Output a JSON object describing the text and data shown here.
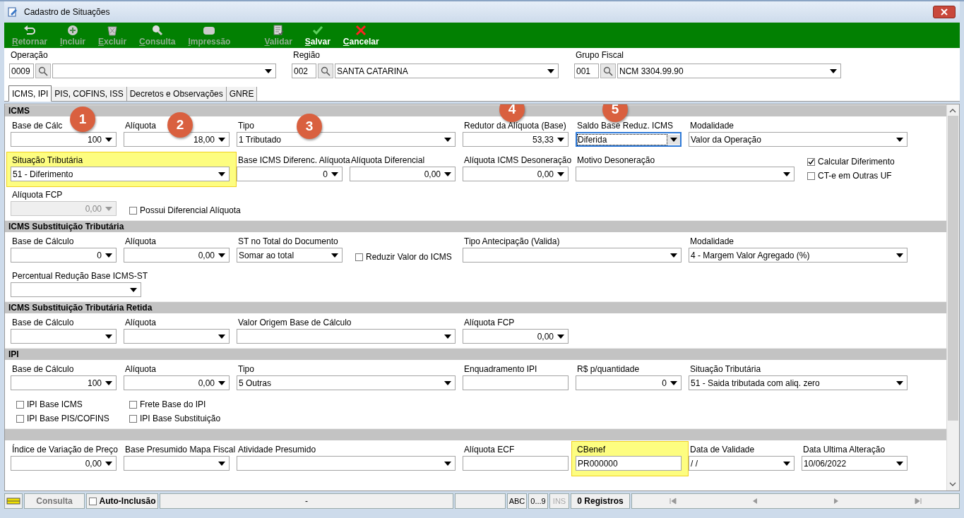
{
  "window": {
    "title": "Cadastro de Situações"
  },
  "toolbar": [
    {
      "label": "Retornar",
      "kind": "back",
      "disabled": true
    },
    {
      "label": "Incluir",
      "kind": "add",
      "disabled": true
    },
    {
      "label": "Excluir",
      "kind": "delete",
      "disabled": true
    },
    {
      "label": "Consulta",
      "kind": "search",
      "disabled": true
    },
    {
      "label": "Impressão",
      "kind": "print",
      "disabled": true
    },
    {
      "label": "Validar",
      "kind": "validate",
      "disabled": true
    },
    {
      "label": "Salvar",
      "kind": "save",
      "disabled": false
    },
    {
      "label": "Cancelar",
      "kind": "cancel",
      "disabled": false
    }
  ],
  "header": [
    {
      "label": "Operação",
      "code": "0009"
    },
    {
      "label": "Região",
      "code": "002",
      "value": "SANTA CATARINA"
    },
    {
      "label": "Grupo Fiscal",
      "code": "001",
      "value": "NCM 3304.99.90"
    }
  ],
  "tabs": [
    {
      "label": "ICMS, IPI",
      "selected": true
    },
    {
      "label": "PIS, COFINS, ISS",
      "selected": false
    },
    {
      "label": "Decretos e Observações",
      "selected": false
    },
    {
      "label": "GNRE",
      "selected": false
    }
  ],
  "sections": [
    {
      "title": "ICMS",
      "lines": [
        {
          "fields": [
            {
              "kind": "number",
              "label": "Base de Cálc",
              "value": "100",
              "callout": "1"
            },
            {
              "kind": "number",
              "label": "Alíquota",
              "value": "18,00",
              "callout": "2"
            },
            {
              "kind": "combo",
              "label": "Tipo",
              "value": "1 Tributado",
              "callout": "3"
            },
            {
              "kind": "number",
              "label": "Redutor da Alíquota (Base)",
              "value": "53,33",
              "callout": "4"
            },
            {
              "kind": "combo",
              "label": "Saldo Base Reduz. ICMS",
              "value": "Diferida",
              "callout": "5",
              "focused": true
            },
            {
              "kind": "combo",
              "label": "Modalidade",
              "value": "Valor da Operação"
            }
          ]
        },
        {
          "fields": [
            {
              "kind": "combo",
              "label": "Situação Tributária",
              "value": "51 - Diferimento",
              "highlighted": true
            },
            {
              "kind": "number",
              "label": "Base ICMS Diferenc. Alíquota",
              "value": "0"
            },
            {
              "kind": "number",
              "label": "Alíquota Diferencial",
              "value": "0,00"
            },
            {
              "kind": "number",
              "label": "Alíquota ICMS Desoneração",
              "value": "0,00"
            },
            {
              "kind": "combo",
              "label": "Motivo Desoneração"
            },
            {
              "kind": "checks",
              "checks": [
                {
                  "label": "Calcular Diferimento",
                  "checked": true
                },
                {
                  "label": "CT-e em Outras UF",
                  "checked": false
                }
              ]
            }
          ]
        },
        {
          "fields": [
            {
              "kind": "number",
              "label": "Alíquota FCP",
              "value": "0,00",
              "disabled": true
            },
            {
              "kind": "checks",
              "checks": [
                {
                  "label": "Possui Diferencial Alíquota",
                  "checked": false
                }
              ]
            }
          ]
        }
      ]
    },
    {
      "title": "ICMS Substituição Tributária",
      "lines": [
        {
          "fields": [
            {
              "kind": "number",
              "label": "Base de Cálculo",
              "value": "0"
            },
            {
              "kind": "number",
              "label": "Alíquota",
              "value": "0,00"
            },
            {
              "kind": "combo",
              "label": "ST no Total do Documento",
              "value": "Somar ao total"
            },
            {
              "kind": "checks",
              "checks": [
                {
                  "label": "Reduzir Valor do ICMS",
                  "checked": false
                }
              ]
            },
            {
              "kind": "combo",
              "label": "Tipo Antecipação (Valida)"
            },
            {
              "kind": "combo",
              "label": "Modalidade",
              "value": "4 - Margem Valor Agregado (%)"
            }
          ]
        },
        {
          "fields": [
            {
              "kind": "combo",
              "label": "Percentual Redução Base ICMS-ST"
            }
          ]
        }
      ]
    },
    {
      "title": "ICMS Substituição Tributária Retida",
      "lines": [
        {
          "fields": [
            {
              "kind": "number",
              "label": "Base de Cálculo"
            },
            {
              "kind": "number",
              "label": "Alíquota"
            },
            {
              "kind": "combo",
              "label": "Valor Origem Base de Cálculo"
            },
            {
              "kind": "number",
              "label": "Alíquota FCP",
              "value": "0,00"
            }
          ]
        }
      ]
    },
    {
      "title": "IPI",
      "lines": [
        {
          "fields": [
            {
              "kind": "number",
              "label": "Base de Cálculo",
              "value": "100"
            },
            {
              "kind": "number",
              "label": "Alíquota",
              "value": "0,00"
            },
            {
              "kind": "combo",
              "label": "Tipo",
              "value": "5 Outras"
            },
            {
              "kind": "text",
              "label": "Enquadramento IPI"
            },
            {
              "kind": "number",
              "label": "R$ p/quantidade",
              "value": "0"
            },
            {
              "kind": "combo",
              "label": "Situação Tributária",
              "value": "51 - Saida tributada com aliq. zero"
            }
          ]
        },
        {
          "fields": [
            {
              "kind": "checks",
              "checks": [
                {
                  "label": "IPI Base ICMS",
                  "checked": false
                },
                {
                  "label": "IPI Base PIS/COFINS",
                  "checked": false
                }
              ]
            },
            {
              "kind": "checks",
              "checks": [
                {
                  "label": "Frete Base do IPI",
                  "checked": false
                },
                {
                  "label": "IPI Base Substituição",
                  "checked": false
                }
              ]
            }
          ]
        }
      ]
    },
    {
      "lines": [
        {
          "fields": [
            {
              "kind": "number",
              "label": "Índice de Variação de Preço",
              "value": "0,00"
            },
            {
              "kind": "number",
              "label": "Base Presumido Mapa Fiscal"
            },
            {
              "kind": "combo",
              "label": "Atividade Presumido"
            },
            {
              "kind": "text",
              "label": "Alíquota ECF"
            },
            {
              "kind": "text",
              "label": "CBenef",
              "value": "PR000000",
              "highlighted": true
            },
            {
              "kind": "combo",
              "label": "Data de Validade",
              "value": " / /"
            },
            {
              "kind": "combo",
              "label": "Data Ultima Alteração",
              "value": "10/06/2022"
            }
          ]
        }
      ]
    }
  ],
  "status_bar": {
    "mode": "Consulta",
    "auto_inclusion": {
      "label": "Auto-Inclusão",
      "checked": false
    },
    "field": "-",
    "indicators": [
      {
        "label": "ABC",
        "active": true
      },
      {
        "label": "0...9",
        "active": true
      },
      {
        "label": "INS",
        "active": false
      }
    ],
    "records": "0 Registros"
  }
}
